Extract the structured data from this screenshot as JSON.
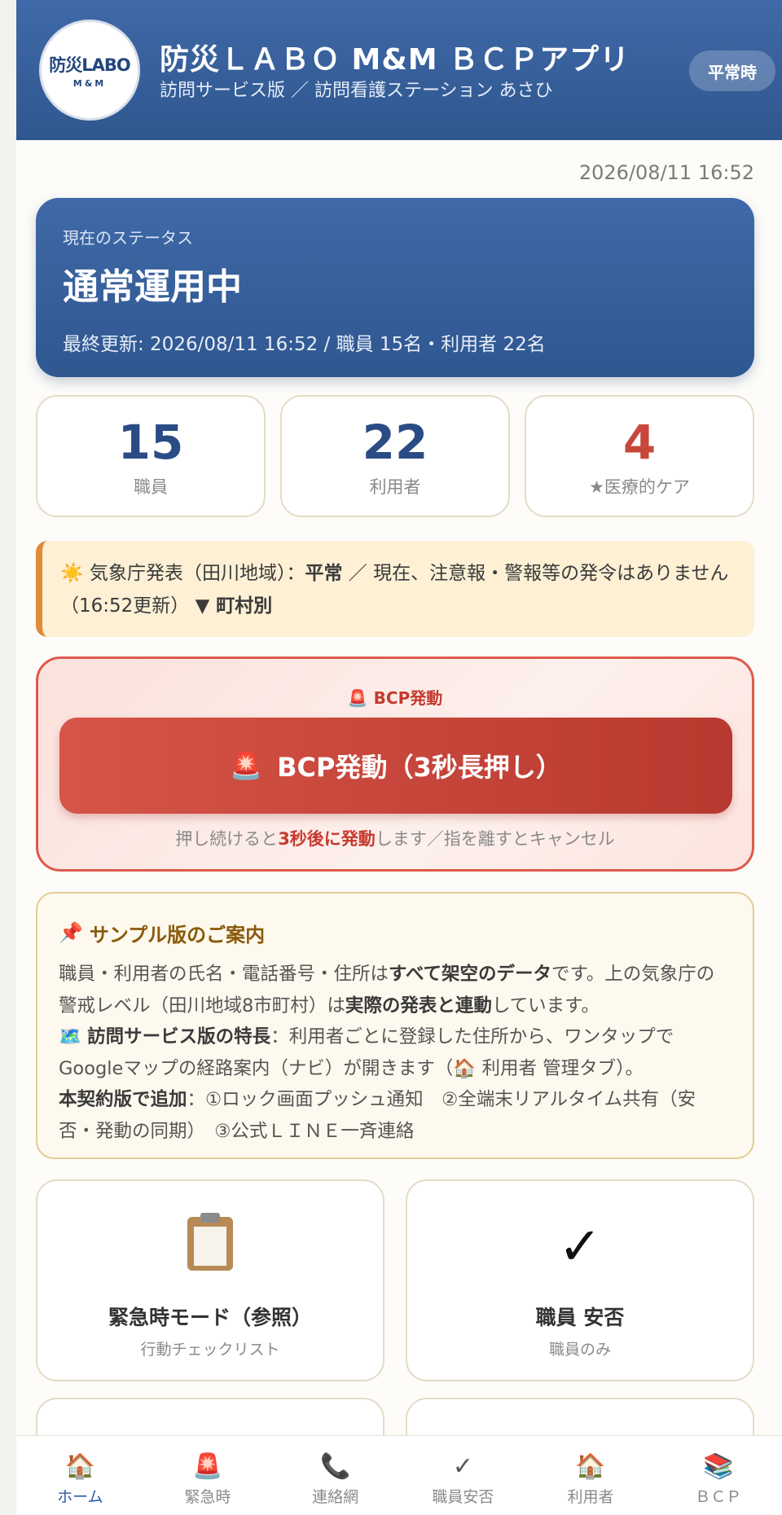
{
  "header": {
    "logo_main": "防災LABO",
    "logo_sub": "M&M",
    "title": "防災ＬＡＢＯ M&M ＢＣＰアプリ",
    "subtitle": "訪問サービス版 ／ 訪問看護ステーション あさひ",
    "mode_badge": "平常時"
  },
  "timestamp": "2026/08/11 16:52",
  "status_card": {
    "label": "現在のステータス",
    "value": "通常運用中",
    "meta": "最終更新: 2026/08/11 16:52 / 職員 15名・利用者 22名"
  },
  "stats": [
    {
      "value": "15",
      "label": "職員"
    },
    {
      "value": "22",
      "label": "利用者"
    },
    {
      "value": "4",
      "label": "★医療的ケア"
    }
  ],
  "weather": {
    "icon": "sun-icon",
    "prefix": "気象庁発表（田川地域）：",
    "level": "平常",
    "text": "／ 現在、注意報・警報等の発令はありません（16:52更新）",
    "toggle": "▼ 町村別"
  },
  "bcp": {
    "title": "BCP発動",
    "button_label": "BCP発動（3秒長押し）",
    "hint_before": "押し続けると",
    "hint_strong": "3秒後に発動",
    "hint_after": "します／指を離すとキャンセル",
    "accent_color": "#c63a2f"
  },
  "notice": {
    "title": "サンプル版のご案内",
    "l1a": "職員・利用者の氏名・電話番号・住所は",
    "l1b": "すべて架空のデータ",
    "l1c": "です。上の気象庁の警戒レベル（田川地域8市町村）は",
    "l1d": "実際の発表と連動",
    "l1e": "しています。",
    "l2a": "訪問サービス版の特長",
    "l2b": "：利用者ごとに登録した住所から、ワンタップでGoogleマップの経路案内（ナビ）が開きます（",
    "l2c": " 利用者 管理タブ）。",
    "l3a": "本契約版で追加",
    "l3b": "：①ロック画面プッシュ通知　②全端末リアルタイム共有（安否・発動の同期）　③公式ＬＩＮＥ一斉連絡"
  },
  "nav_cards": [
    {
      "icon": "clipboard-icon",
      "title": "緊急時モード（参照）",
      "sub": "行動チェックリスト"
    },
    {
      "icon": "checkmark-icon",
      "title": "職員 安否",
      "sub": "職員のみ"
    }
  ],
  "bottom_nav": [
    {
      "icon": "house-icon",
      "label": "ホーム",
      "active": true
    },
    {
      "icon": "siren-icon",
      "label": "緊急時"
    },
    {
      "icon": "phone-icon",
      "label": "連絡網"
    },
    {
      "icon": "check-icon",
      "label": "職員安否"
    },
    {
      "icon": "house-icon",
      "label": "利用者"
    },
    {
      "icon": "books-icon",
      "label": "ＢＣＰ"
    }
  ],
  "colors": {
    "brand_blue": "#2f578f",
    "alert_red": "#c8473b",
    "notice_gold": "#8a5a0a"
  }
}
